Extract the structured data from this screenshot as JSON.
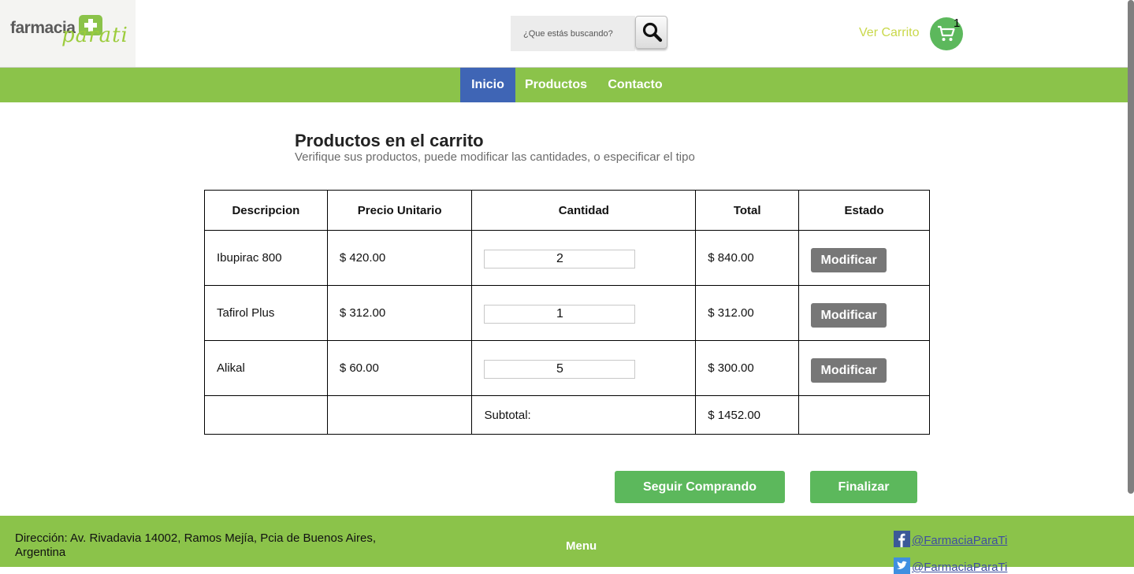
{
  "header": {
    "logo_text_main": "farmacia",
    "logo_text_script": "parati",
    "search_placeholder": "¿Que estás buscando?",
    "cart_link_label": "Ver Carrito",
    "cart_count": "1"
  },
  "nav": {
    "items": [
      {
        "label": "Inicio",
        "active": true
      },
      {
        "label": "Productos",
        "active": false
      },
      {
        "label": "Contacto",
        "active": false
      }
    ]
  },
  "page": {
    "title": "Productos en el carrito",
    "subtitle": "Verifique sus productos, puede modificar las cantidades, o especificar el tipo"
  },
  "table": {
    "headers": [
      "Descripcion",
      "Precio Unitario",
      "Cantidad",
      "Total",
      "Estado"
    ],
    "rows": [
      {
        "description": "Ibupirac 800",
        "unit_price": "$ 420.00",
        "quantity": "2",
        "total": "$ 840.00",
        "action": "Modificar"
      },
      {
        "description": "Tafirol Plus",
        "unit_price": "$ 312.00",
        "quantity": "1",
        "total": "$ 312.00",
        "action": "Modificar"
      },
      {
        "description": "Alikal",
        "unit_price": "$ 60.00",
        "quantity": "5",
        "total": "$ 300.00",
        "action": "Modificar"
      }
    ],
    "subtotal_label": "Subtotal:",
    "subtotal_value": "$ 1452.00"
  },
  "actions": {
    "continue_label": "Seguir Comprando",
    "finish_label": "Finalizar"
  },
  "footer": {
    "address": "Dirección: Av. Rivadavia 14002, Ramos Mejía, Pcia de Buenos Aires, Argentina",
    "menu_label": "Menu",
    "facebook": "@FarmaciaParaTi",
    "twitter": "@FarmaciaParaTi"
  },
  "colors": {
    "brand_green": "#8bc34a",
    "nav_active": "#3f65b5",
    "button_green": "#5cb85c",
    "button_gray": "#777777"
  },
  "icons": [
    "search-icon",
    "cart-icon",
    "facebook-icon",
    "twitter-icon",
    "logo-cross-icon"
  ]
}
